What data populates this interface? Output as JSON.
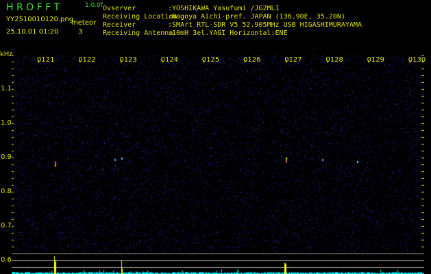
{
  "header": {
    "app_title": "H R O F F T",
    "version": "1.0.0f",
    "filename": "YY2510010120.png",
    "datetime": "25.10.01 01:20",
    "meteor_label": "meteor",
    "meteor_count": "3"
  },
  "info": [
    {
      "label": "Ovserver",
      "value": ":YOSHIKAWA Yasufumi /JG2MLI"
    },
    {
      "label": "Receiving Location",
      "value": ":Nagoya Aichi-pref. JAPAN (136.90E, 35.20N)"
    },
    {
      "label": "Receiver",
      "value": ":SMArt RTL-SDR V5 52.905MHz USB HIGASHIMURAYAMA"
    },
    {
      "label": "Receiving Antenna",
      "value": ":10mH 3el.YAGI Horizontal:ENE"
    }
  ],
  "axis": {
    "unit": "kHz",
    "time_labels": [
      "0121",
      "0122",
      "0123",
      "0124",
      "0125",
      "0126",
      "0127",
      "0128",
      "0129",
      "0130"
    ],
    "freq_labels": [
      "1.1",
      "1.0",
      "0.9",
      "0.8",
      "0.7",
      "0.6"
    ]
  },
  "colors": {
    "background": "#000000",
    "noise": "#1a1aa0",
    "text": "#e8e800",
    "title": "#2fe62f",
    "spectrum": "#00e8f0"
  }
}
